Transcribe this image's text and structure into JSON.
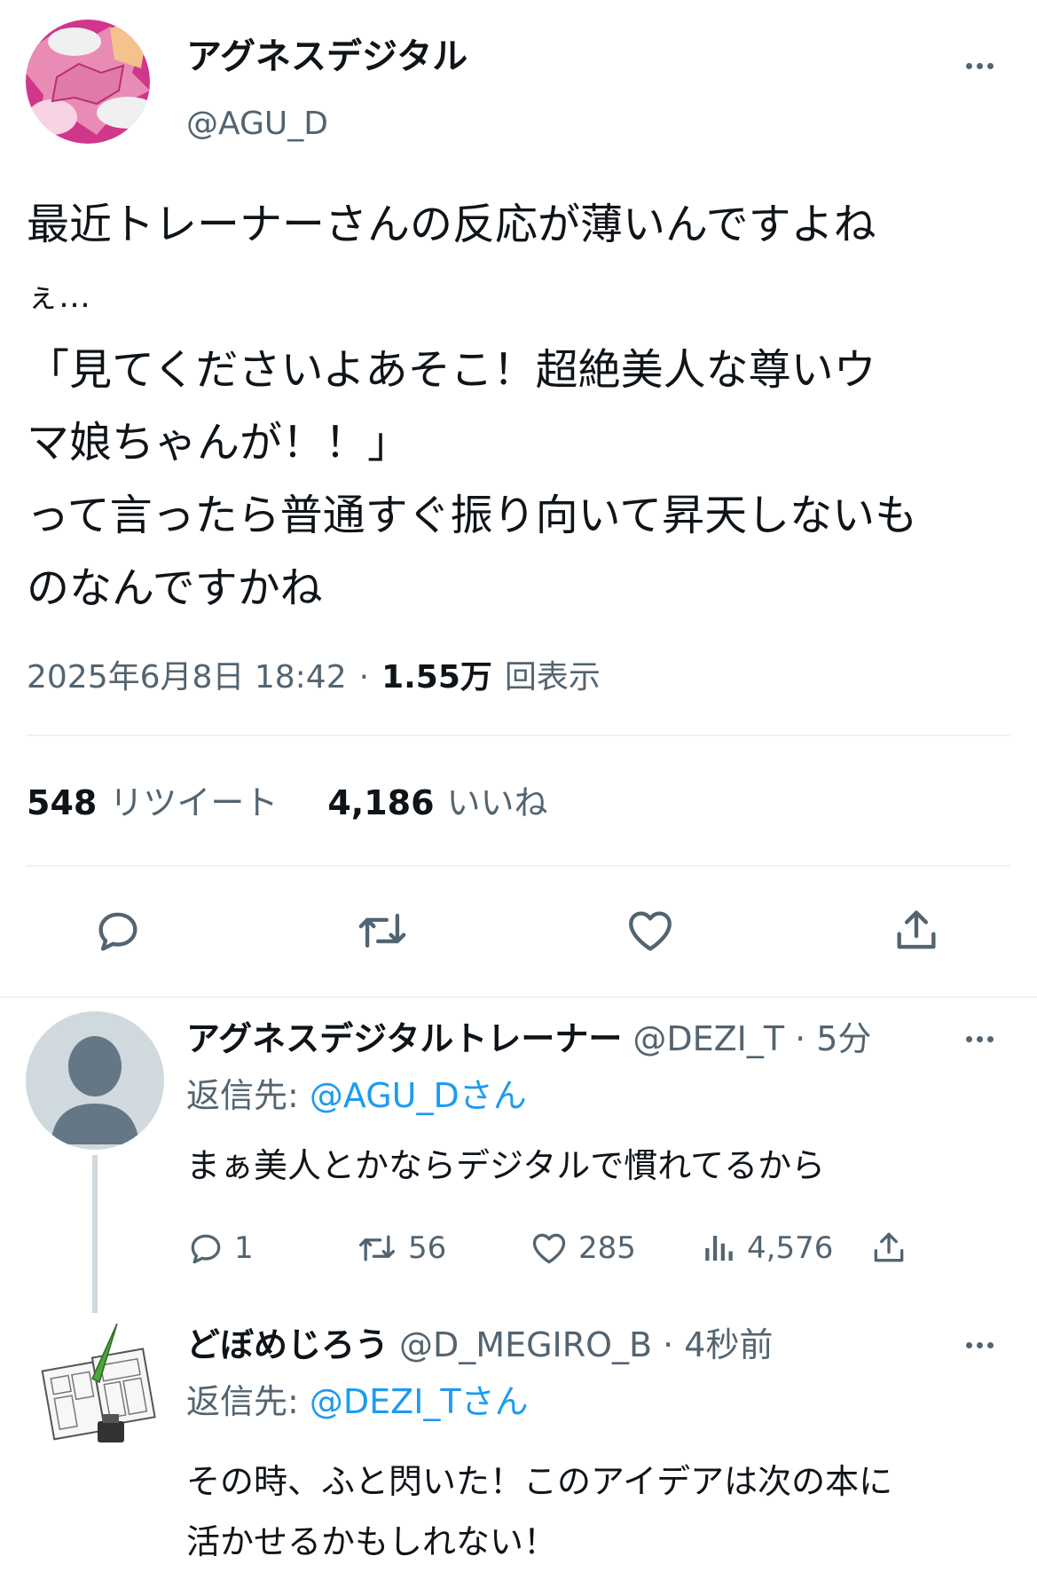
{
  "main_tweet": {
    "display_name": "アグネスデジタル",
    "handle": "@AGU_D",
    "text_lines": [
      "最近トレーナーさんの反応が薄いんですよね",
      "ぇ…",
      "「見てくださいよあそこ！超絶美人な尊いウ",
      "マ娘ちゃんが！！」",
      "って言ったら普通すぐ振り向いて昇天しないも",
      "のなんですかね"
    ],
    "timestamp": "2025年6月8日 18:42",
    "separator": "·",
    "views_count": "1.55万",
    "views_label": "回表示",
    "retweet_count": "548",
    "retweet_label": "リツイート",
    "like_count": "4,186",
    "like_label": "いいね"
  },
  "reply1": {
    "display_name": "アグネスデジタルトレーナー",
    "handle": "@DEZI_T",
    "time": "· 5分",
    "reply_to_label": "返信先:",
    "reply_to_handle": "@AGU_D",
    "reply_to_suffix": "さん",
    "text": "まぁ美人とかならデジタルで慣れてるから",
    "replies": "1",
    "retweets": "56",
    "likes": "285",
    "views": "4,576"
  },
  "reply2": {
    "display_name": "どぼめじろう",
    "handle": "@D_MEGIRO_B",
    "time": "· 4秒前",
    "reply_to_label": "返信先:",
    "reply_to_handle": "@DEZI_T",
    "reply_to_suffix": "さん",
    "text_lines": [
      "その時、ふと閃いた！このアイデアは次の本に",
      "活かせるかもしれない！"
    ]
  },
  "icons": [
    "reply-icon",
    "retweet-icon",
    "like-icon",
    "share-icon",
    "views-icon",
    "more-icon"
  ],
  "colors": {
    "text": "#0f1419",
    "muted": "#536471",
    "link": "#1d9bf0",
    "divider": "#eff3f4"
  }
}
